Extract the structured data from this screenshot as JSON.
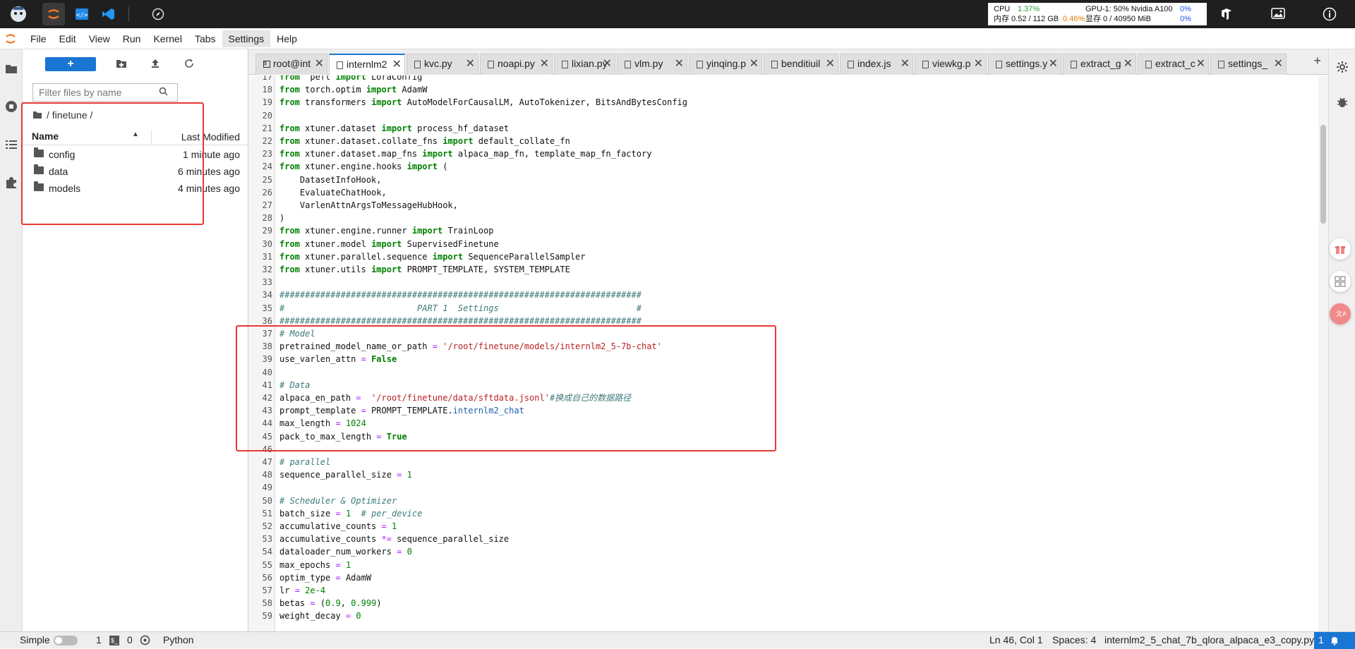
{
  "topbar": {
    "icons": [
      "app-logo-icon",
      "jupyter-icon",
      "code-editor-icon",
      "vscode-icon",
      "compass-icon"
    ],
    "right_icons": [
      "model-icon",
      "image-icon",
      "info-icon"
    ],
    "sys": {
      "cpu_label": "CPU",
      "cpu_val": "1.37%",
      "gpu_label": "GPU-1: 50% Nvidia A100",
      "gpu_val": "0%",
      "mem_label": "内存 0.52 / 112 GB",
      "mem_val": "0.46%",
      "vram_label": "显存 0 / 40950 MiB",
      "vram_val": "0%"
    }
  },
  "menubar": {
    "items": [
      "File",
      "Edit",
      "View",
      "Run",
      "Kernel",
      "Tabs",
      "Settings",
      "Help"
    ],
    "active": "Settings"
  },
  "filepanel": {
    "new_button": "+",
    "filter_placeholder": "Filter files by name",
    "breadcrumb": "/ finetune /",
    "col_name": "Name",
    "col_modified": "Last Modified",
    "files": [
      {
        "name": "config",
        "modified": "1 minute ago"
      },
      {
        "name": "data",
        "modified": "6 minutes ago"
      },
      {
        "name": "models",
        "modified": "4 minutes ago"
      }
    ]
  },
  "tabs": [
    {
      "label": "root@int",
      "active": false,
      "kind": "terminal"
    },
    {
      "label": "internlm2",
      "active": true,
      "kind": "doc"
    },
    {
      "label": "kvc.py",
      "active": false,
      "kind": "doc"
    },
    {
      "label": "noapi.py",
      "active": false,
      "kind": "doc"
    },
    {
      "label": "lixian.py",
      "active": false,
      "kind": "doc"
    },
    {
      "label": "vlm.py",
      "active": false,
      "kind": "doc"
    },
    {
      "label": "yinqing.p",
      "active": false,
      "kind": "doc"
    },
    {
      "label": "benditiuil",
      "active": false,
      "kind": "doc"
    },
    {
      "label": "index.js",
      "active": false,
      "kind": "doc"
    },
    {
      "label": "viewkg.p",
      "active": false,
      "kind": "doc"
    },
    {
      "label": "settings.y",
      "active": false,
      "kind": "doc"
    },
    {
      "label": "extract_g",
      "active": false,
      "kind": "doc"
    },
    {
      "label": "extract_c",
      "active": false,
      "kind": "doc"
    },
    {
      "label": "settings_",
      "active": false,
      "kind": "doc"
    }
  ],
  "add_tab": "+",
  "code_lines": [
    {
      "n": "17",
      "t": [
        [
          "kw",
          "from"
        ],
        [
          "",
          "  peft "
        ],
        [
          "kw",
          "import"
        ],
        [
          "",
          " LoraConfig"
        ]
      ]
    },
    {
      "n": "18",
      "t": [
        [
          "kw",
          "from"
        ],
        [
          "",
          " torch.optim "
        ],
        [
          "kw",
          "import"
        ],
        [
          "",
          " AdamW"
        ]
      ]
    },
    {
      "n": "19",
      "t": [
        [
          "kw",
          "from"
        ],
        [
          "",
          " transformers "
        ],
        [
          "kw",
          "import"
        ],
        [
          "",
          " AutoModelForCausalLM, AutoTokenizer, BitsAndBytesConfig"
        ]
      ]
    },
    {
      "n": "20",
      "t": []
    },
    {
      "n": "21",
      "t": [
        [
          "kw",
          "from"
        ],
        [
          "",
          " xtuner.dataset "
        ],
        [
          "kw",
          "import"
        ],
        [
          "",
          " process_hf_dataset"
        ]
      ]
    },
    {
      "n": "22",
      "t": [
        [
          "kw",
          "from"
        ],
        [
          "",
          " xtuner.dataset.collate_fns "
        ],
        [
          "kw",
          "import"
        ],
        [
          "",
          " default_collate_fn"
        ]
      ]
    },
    {
      "n": "23",
      "t": [
        [
          "kw",
          "from"
        ],
        [
          "",
          " xtuner.dataset.map_fns "
        ],
        [
          "kw",
          "import"
        ],
        [
          "",
          " alpaca_map_fn, template_map_fn_factory"
        ]
      ]
    },
    {
      "n": "24",
      "t": [
        [
          "kw",
          "from"
        ],
        [
          "",
          " xtuner.engine.hooks "
        ],
        [
          "kw",
          "import"
        ],
        [
          "",
          " ("
        ]
      ]
    },
    {
      "n": "25",
      "t": [
        [
          "",
          "    DatasetInfoHook,"
        ]
      ]
    },
    {
      "n": "26",
      "t": [
        [
          "",
          "    EvaluateChatHook,"
        ]
      ]
    },
    {
      "n": "27",
      "t": [
        [
          "",
          "    VarlenAttnArgsToMessageHubHook,"
        ]
      ]
    },
    {
      "n": "28",
      "t": [
        [
          "",
          ")"
        ]
      ]
    },
    {
      "n": "29",
      "t": [
        [
          "kw",
          "from"
        ],
        [
          "",
          " xtuner.engine.runner "
        ],
        [
          "kw",
          "import"
        ],
        [
          "",
          " TrainLoop"
        ]
      ]
    },
    {
      "n": "30",
      "t": [
        [
          "kw",
          "from"
        ],
        [
          "",
          " xtuner.model "
        ],
        [
          "kw",
          "import"
        ],
        [
          "",
          " SupervisedFinetune"
        ]
      ]
    },
    {
      "n": "31",
      "t": [
        [
          "kw",
          "from"
        ],
        [
          "",
          " xtuner.parallel.sequence "
        ],
        [
          "kw",
          "import"
        ],
        [
          "",
          " SequenceParallelSampler"
        ]
      ]
    },
    {
      "n": "32",
      "t": [
        [
          "kw",
          "from"
        ],
        [
          "",
          " xtuner.utils "
        ],
        [
          "kw",
          "import"
        ],
        [
          "",
          " PROMPT_TEMPLATE, SYSTEM_TEMPLATE"
        ]
      ]
    },
    {
      "n": "33",
      "t": []
    },
    {
      "n": "34",
      "t": [
        [
          "cm",
          "#######################################################################"
        ]
      ]
    },
    {
      "n": "35",
      "t": [
        [
          "cm",
          "#                          PART 1  Settings                           #"
        ]
      ]
    },
    {
      "n": "36",
      "t": [
        [
          "cm",
          "#######################################################################"
        ]
      ]
    },
    {
      "n": "37",
      "t": [
        [
          "cm",
          "# Model"
        ]
      ]
    },
    {
      "n": "38",
      "t": [
        [
          "",
          "pretrained_model_name_or_path "
        ],
        [
          "op",
          "="
        ],
        [
          "",
          " "
        ],
        [
          "st",
          "'/root/finetune/models/internlm2_5-7b-chat'"
        ]
      ]
    },
    {
      "n": "39",
      "t": [
        [
          "",
          "use_varlen_attn "
        ],
        [
          "op",
          "="
        ],
        [
          "",
          " "
        ],
        [
          "kw",
          "False"
        ]
      ]
    },
    {
      "n": "40",
      "t": []
    },
    {
      "n": "41",
      "t": [
        [
          "cm",
          "# Data"
        ]
      ]
    },
    {
      "n": "42",
      "t": [
        [
          "",
          "alpaca_en_path "
        ],
        [
          "op",
          "="
        ],
        [
          "",
          "  "
        ],
        [
          "st",
          "'/root/finetune/data/sftdata.jsonl'"
        ],
        [
          "cm",
          "#换成自己的数据路径"
        ]
      ]
    },
    {
      "n": "43",
      "t": [
        [
          "",
          "prompt_template "
        ],
        [
          "op",
          "="
        ],
        [
          "",
          " PROMPT_TEMPLATE."
        ],
        [
          "at",
          "internlm2_chat"
        ]
      ]
    },
    {
      "n": "44",
      "t": [
        [
          "",
          "max_length "
        ],
        [
          "op",
          "="
        ],
        [
          "",
          " "
        ],
        [
          "nu",
          "1024"
        ]
      ]
    },
    {
      "n": "45",
      "t": [
        [
          "",
          "pack_to_max_length "
        ],
        [
          "op",
          "="
        ],
        [
          "",
          " "
        ],
        [
          "kw",
          "True"
        ]
      ]
    },
    {
      "n": "46",
      "t": []
    },
    {
      "n": "47",
      "t": [
        [
          "cm",
          "# parallel"
        ]
      ]
    },
    {
      "n": "48",
      "t": [
        [
          "",
          "sequence_parallel_size "
        ],
        [
          "op",
          "="
        ],
        [
          "",
          " "
        ],
        [
          "nu",
          "1"
        ]
      ]
    },
    {
      "n": "49",
      "t": []
    },
    {
      "n": "50",
      "t": [
        [
          "cm",
          "# Scheduler & Optimizer"
        ]
      ]
    },
    {
      "n": "51",
      "t": [
        [
          "",
          "batch_size "
        ],
        [
          "op",
          "="
        ],
        [
          "",
          " "
        ],
        [
          "nu",
          "1"
        ],
        [
          "",
          "  "
        ],
        [
          "cm",
          "# per_device"
        ]
      ]
    },
    {
      "n": "52",
      "t": [
        [
          "",
          "accumulative_counts "
        ],
        [
          "op",
          "="
        ],
        [
          "",
          " "
        ],
        [
          "nu",
          "1"
        ]
      ]
    },
    {
      "n": "53",
      "t": [
        [
          "",
          "accumulative_counts "
        ],
        [
          "op",
          "*="
        ],
        [
          "",
          " sequence_parallel_size"
        ]
      ]
    },
    {
      "n": "54",
      "t": [
        [
          "",
          "dataloader_num_workers "
        ],
        [
          "op",
          "="
        ],
        [
          "",
          " "
        ],
        [
          "nu",
          "0"
        ]
      ]
    },
    {
      "n": "55",
      "t": [
        [
          "",
          "max_epochs "
        ],
        [
          "op",
          "="
        ],
        [
          "",
          " "
        ],
        [
          "nu",
          "1"
        ]
      ]
    },
    {
      "n": "56",
      "t": [
        [
          "",
          "optim_type "
        ],
        [
          "op",
          "="
        ],
        [
          "",
          " AdamW"
        ]
      ]
    },
    {
      "n": "57",
      "t": [
        [
          "",
          "lr "
        ],
        [
          "op",
          "="
        ],
        [
          "",
          " "
        ],
        [
          "nu",
          "2e-4"
        ]
      ]
    },
    {
      "n": "58",
      "t": [
        [
          "",
          "betas "
        ],
        [
          "op",
          "="
        ],
        [
          "",
          " ("
        ],
        [
          "nu",
          "0.9"
        ],
        [
          "",
          ", "
        ],
        [
          "nu",
          "0.999"
        ],
        [
          "",
          ")"
        ]
      ]
    },
    {
      "n": "59",
      "t": [
        [
          "",
          "weight_decay "
        ],
        [
          "op",
          "="
        ],
        [
          "",
          " "
        ],
        [
          "nu",
          "0"
        ]
      ]
    }
  ],
  "statusbar": {
    "mode": "Simple",
    "terminals_count": "1",
    "kernels_count": "0",
    "kernel_name": "Python",
    "cursor": "Ln 46, Col 1",
    "spaces": "Spaces: 4",
    "filename": "internlm2_5_chat_7b_qlora_alpaca_e3_copy.py",
    "notifications": "1"
  },
  "colors": {
    "accent": "#1976d2",
    "highlight_box": "#e53935",
    "topbar_bg": "#1f1f1f"
  }
}
